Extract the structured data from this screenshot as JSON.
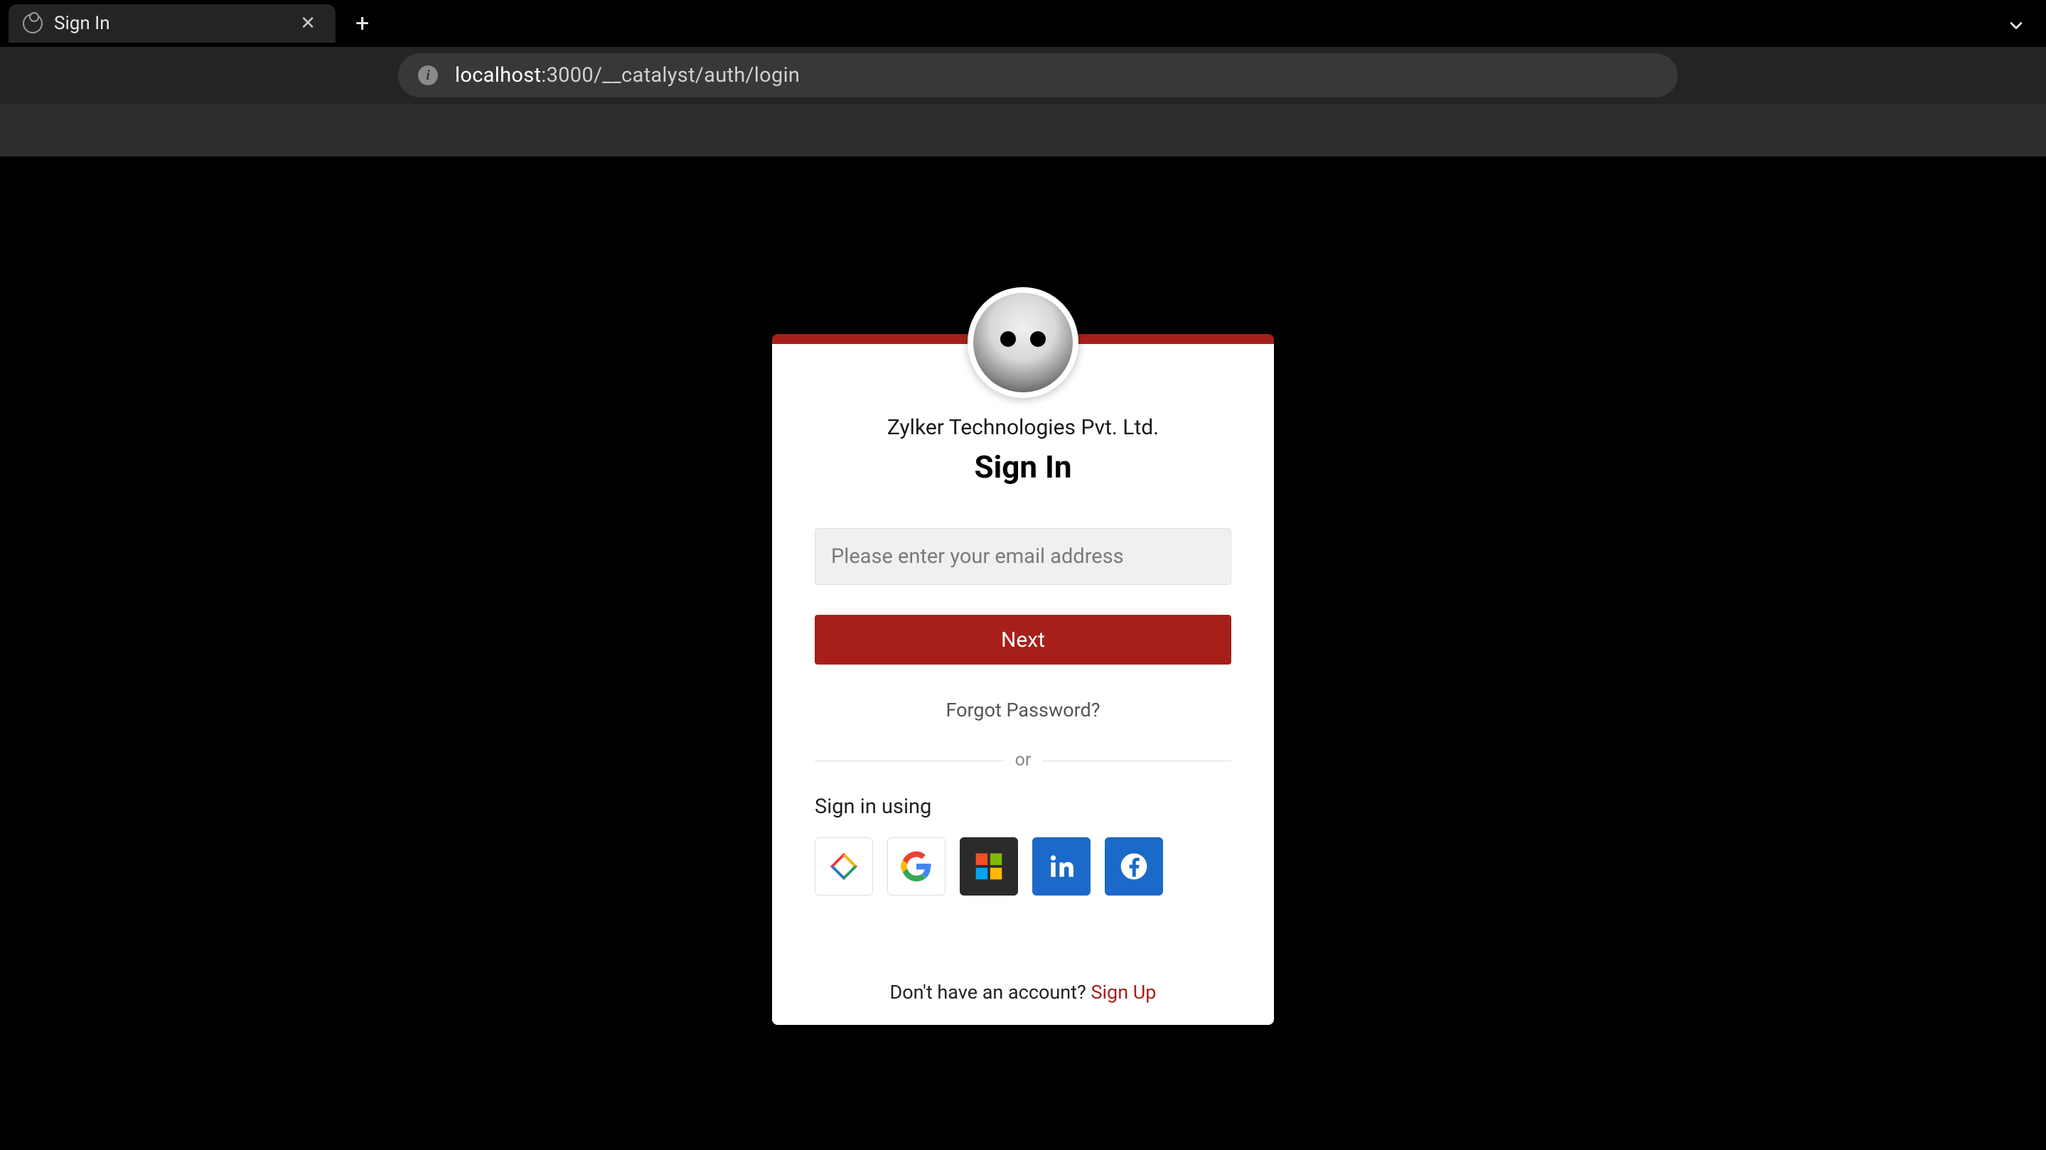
{
  "browser": {
    "tab_title": "Sign In",
    "url_host": "localhost",
    "url_path": ":3000/__catalyst/auth/login"
  },
  "login": {
    "company_name": "Zylker Technologies Pvt. Ltd.",
    "title": "Sign In",
    "email_placeholder": "Please enter your email address",
    "next_label": "Next",
    "forgot_label": "Forgot Password?",
    "separator_label": "or",
    "signin_using_label": "Sign in using",
    "providers": {
      "zoho": "Zoho",
      "google": "Google",
      "microsoft": "Microsoft",
      "linkedin": "LinkedIn",
      "facebook": "Facebook"
    },
    "footer_text": "Don't have an account? ",
    "signup_label": "Sign Up"
  },
  "colors": {
    "accent": "#a71f1a",
    "linkedin": "#1b6ac9",
    "facebook": "#1b6ac9",
    "microsoft_bg": "#2b2b2b"
  }
}
